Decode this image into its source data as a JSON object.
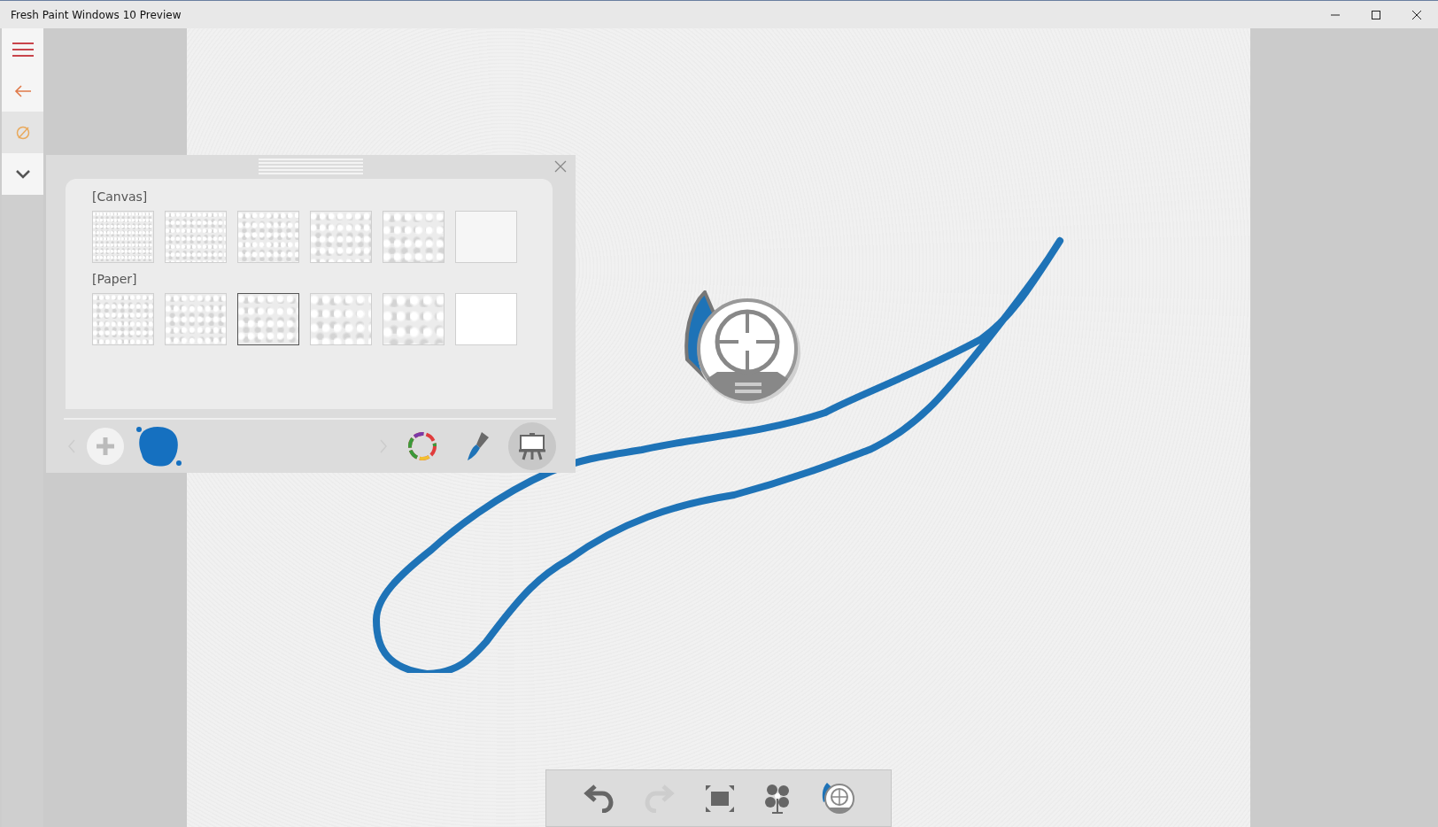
{
  "window": {
    "title": "Fresh Paint Windows 10 Preview"
  },
  "sidebar": {
    "items": [
      {
        "kind": "menu",
        "selected": false
      },
      {
        "kind": "back",
        "selected": false
      },
      {
        "kind": "paint",
        "selected": true
      },
      {
        "kind": "more",
        "selected": false
      }
    ]
  },
  "panel": {
    "sections": [
      {
        "label": "[Canvas]",
        "textures": [
          {
            "selected": false
          },
          {
            "selected": false
          },
          {
            "selected": false
          },
          {
            "selected": false
          },
          {
            "selected": false
          },
          {
            "selected": false
          }
        ]
      },
      {
        "label": "[Paper]",
        "textures": [
          {
            "selected": false
          },
          {
            "selected": false
          },
          {
            "selected": true
          },
          {
            "selected": false
          },
          {
            "selected": false
          },
          {
            "selected": false
          }
        ]
      }
    ],
    "tools": [
      {
        "kind": "colors",
        "selected": false
      },
      {
        "kind": "brush",
        "selected": false
      },
      {
        "kind": "canvas",
        "selected": true
      }
    ]
  },
  "toolbar": [
    {
      "kind": "undo",
      "disabled": false
    },
    {
      "kind": "redo",
      "disabled": true
    },
    {
      "kind": "fit",
      "disabled": false
    },
    {
      "kind": "dry",
      "disabled": false
    },
    {
      "kind": "navigator",
      "disabled": false
    }
  ]
}
